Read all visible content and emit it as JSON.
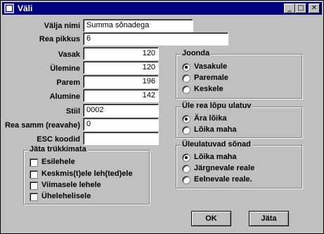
{
  "window": {
    "title": "Väli"
  },
  "titlebar_buttons": [
    {
      "name": "minimize-button",
      "glyph": "_"
    },
    {
      "name": "maximize-button",
      "glyph": "□"
    },
    {
      "name": "close-button",
      "glyph": "✕"
    }
  ],
  "fields": {
    "valja_nimi": {
      "label": "Välja nimi",
      "value": "Summa sõnadega"
    },
    "rea_pikkus": {
      "label": "Rea pikkus",
      "value": "6"
    },
    "vasak": {
      "label": "Vasak",
      "value": "120"
    },
    "ulemine": {
      "label": "Ülemine",
      "value": "120"
    },
    "parem": {
      "label": "Parem",
      "value": "196"
    },
    "alumine": {
      "label": "Alumine",
      "value": "142"
    },
    "stiil": {
      "label": "Stiil",
      "value": "0002"
    },
    "rea_samm": {
      "label": "Rea samm (reavahe)",
      "value": "0"
    },
    "esc_koodid": {
      "label": "ESC koodid",
      "value": ""
    }
  },
  "skip_print": {
    "title": "Jäta trükkimata",
    "items": [
      {
        "label": "Esilehele",
        "checked": false
      },
      {
        "label": "Keskmis(t)ele leh(ted)ele",
        "checked": false
      },
      {
        "label": "Viimasele lehele",
        "checked": false
      },
      {
        "label": "Ühelehelisele",
        "checked": false
      }
    ]
  },
  "align": {
    "title": "Joonda",
    "options": [
      {
        "label": "Vasakule",
        "selected": true
      },
      {
        "label": "Paremale",
        "selected": false
      },
      {
        "label": "Keskele",
        "selected": false
      }
    ]
  },
  "overflow": {
    "title": "Üle rea lõpu ulatuv",
    "options": [
      {
        "label": "Ära lõika",
        "selected": true
      },
      {
        "label": "Lõika maha",
        "selected": false
      }
    ]
  },
  "long_words": {
    "title": "Üleulatuvad sõnad",
    "options": [
      {
        "label": "Lõika maha",
        "selected": true
      },
      {
        "label": "Järgnevale reale",
        "selected": false
      },
      {
        "label": "Eelnevale reale.",
        "selected": false
      }
    ]
  },
  "buttons": {
    "ok": "OK",
    "cancel": "Jäta"
  }
}
